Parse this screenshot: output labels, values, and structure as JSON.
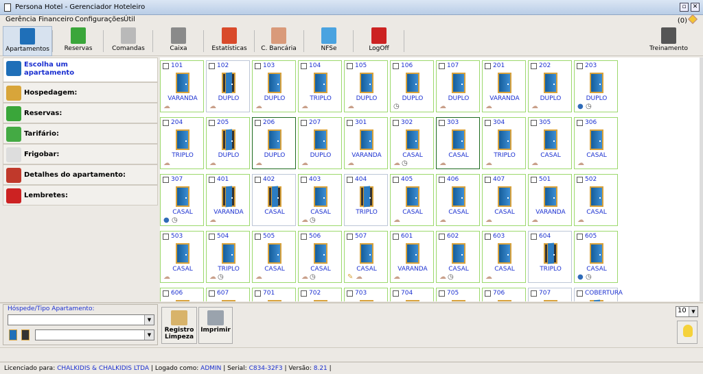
{
  "window": {
    "title": "Persona Hotel - Gerenciador Hoteleiro"
  },
  "menu": [
    "Gerência",
    "Financeiro",
    "Configurações",
    "Útil"
  ],
  "notification_count": "(0)",
  "toolbar": [
    {
      "label": "Apartamentos",
      "icon": "door-icon",
      "color": "#1f6fb8",
      "active": true
    },
    {
      "label": "Reservas",
      "icon": "calendar-icon",
      "color": "#3aa63a"
    },
    {
      "label": "Comandas",
      "icon": "cutlery-icon",
      "color": "#b9b9b9"
    },
    {
      "label": "Caixa",
      "icon": "cash-register-icon",
      "color": "#8a8a8a"
    },
    {
      "label": "Estatísticas",
      "icon": "chart-icon",
      "color": "#d94a2b"
    },
    {
      "label": "C. Bancária",
      "icon": "piggy-bank-icon",
      "color": "#d99a7a"
    },
    {
      "label": "NFSe",
      "icon": "nfse-icon",
      "color": "#4aa3e0"
    },
    {
      "label": "LogOff",
      "icon": "lock-icon",
      "color": "#cc2222"
    },
    {
      "label": "Treinamento",
      "icon": "film-icon",
      "color": "#555555"
    }
  ],
  "sidebar": [
    {
      "label": "Escolha um apartamento",
      "icon": "door-icon",
      "color": "#1f6fb8"
    },
    {
      "label": "Hospedagem:",
      "icon": "bell-icon",
      "color": "#d8a53a"
    },
    {
      "label": "Reservas:",
      "icon": "calendar-icon",
      "color": "#3aa63a"
    },
    {
      "label": "Tarifário:",
      "icon": "dollar-icon",
      "color": "#44aa44"
    },
    {
      "label": "Frigobar:",
      "icon": "fridge-icon",
      "color": "#dddddd"
    },
    {
      "label": "Detalhes do apartamento:",
      "icon": "sofa-icon",
      "color": "#c0392b"
    },
    {
      "label": "Lembretes:",
      "icon": "alarm-icon",
      "color": "#cc2222"
    }
  ],
  "rooms": [
    {
      "num": "101",
      "type": "VARANDA",
      "door": "closed",
      "border": "green",
      "status": [
        "clean"
      ]
    },
    {
      "num": "102",
      "type": "DUPLO",
      "door": "open",
      "border": "gray",
      "status": [
        "clean"
      ]
    },
    {
      "num": "103",
      "type": "DUPLO",
      "door": "closed",
      "border": "green",
      "status": [
        "clean"
      ]
    },
    {
      "num": "104",
      "type": "TRIPLO",
      "door": "closed",
      "border": "green",
      "status": [
        "clean"
      ]
    },
    {
      "num": "105",
      "type": "DUPLO",
      "door": "closed",
      "border": "green",
      "status": [
        "clean"
      ]
    },
    {
      "num": "106",
      "type": "DUPLO",
      "door": "closed",
      "border": "green",
      "status": [
        "clock"
      ]
    },
    {
      "num": "107",
      "type": "DUPLO",
      "door": "closed",
      "border": "green",
      "status": [
        "clean"
      ]
    },
    {
      "num": "201",
      "type": "VARANDA",
      "door": "closed",
      "border": "green",
      "status": [
        "clean"
      ]
    },
    {
      "num": "202",
      "type": "DUPLO",
      "door": "closed",
      "border": "green",
      "status": [
        "clean"
      ]
    },
    {
      "num": "203",
      "type": "DUPLO",
      "door": "closed",
      "border": "green",
      "status": [
        "guests",
        "clock"
      ]
    },
    {
      "num": "204",
      "type": "TRIPLO",
      "door": "closed",
      "border": "green",
      "status": [
        "clean"
      ]
    },
    {
      "num": "205",
      "type": "DUPLO",
      "door": "open",
      "border": "green",
      "status": [
        "clean"
      ]
    },
    {
      "num": "206",
      "type": "DUPLO",
      "door": "closed",
      "border": "dark",
      "status": [
        "clean"
      ]
    },
    {
      "num": "207",
      "type": "DUPLO",
      "door": "closed",
      "border": "green",
      "status": [
        "clean"
      ]
    },
    {
      "num": "301",
      "type": "VARANDA",
      "door": "closed",
      "border": "green",
      "status": [
        "clean"
      ]
    },
    {
      "num": "302",
      "type": "CASAL",
      "door": "closed",
      "border": "green",
      "status": [
        "clean",
        "clock"
      ]
    },
    {
      "num": "303",
      "type": "CASAL",
      "door": "closed",
      "border": "dark",
      "status": [
        "clean"
      ]
    },
    {
      "num": "304",
      "type": "TRIPLO",
      "door": "closed",
      "border": "green",
      "status": [
        "clean"
      ]
    },
    {
      "num": "305",
      "type": "CASAL",
      "door": "closed",
      "border": "green",
      "status": [
        "clean"
      ]
    },
    {
      "num": "306",
      "type": "CASAL",
      "door": "closed",
      "border": "green",
      "status": [
        "clean"
      ]
    },
    {
      "num": "307",
      "type": "CASAL",
      "door": "closed",
      "border": "green",
      "status": [
        "guests",
        "clock"
      ]
    },
    {
      "num": "401",
      "type": "VARANDA",
      "door": "open",
      "border": "green",
      "status": [
        "clean"
      ]
    },
    {
      "num": "402",
      "type": "CASAL",
      "door": "open",
      "border": "gray",
      "status": []
    },
    {
      "num": "403",
      "type": "CASAL",
      "door": "closed",
      "border": "green",
      "status": [
        "clean",
        "clock"
      ]
    },
    {
      "num": "404",
      "type": "TRIPLO",
      "door": "open",
      "border": "gray",
      "status": []
    },
    {
      "num": "405",
      "type": "CASAL",
      "door": "closed",
      "border": "green",
      "status": [
        "clean"
      ]
    },
    {
      "num": "406",
      "type": "CASAL",
      "door": "closed",
      "border": "green",
      "status": [
        "clean"
      ]
    },
    {
      "num": "407",
      "type": "CASAL",
      "door": "closed",
      "border": "green",
      "status": [
        "clean"
      ]
    },
    {
      "num": "501",
      "type": "VARANDA",
      "door": "closed",
      "border": "green",
      "status": [
        "clean"
      ]
    },
    {
      "num": "502",
      "type": "CASAL",
      "door": "closed",
      "border": "green",
      "status": [
        "clean"
      ]
    },
    {
      "num": "503",
      "type": "CASAL",
      "door": "closed",
      "border": "green",
      "status": [
        "clean"
      ]
    },
    {
      "num": "504",
      "type": "TRIPLO",
      "door": "closed",
      "border": "green",
      "status": [
        "clean",
        "clock"
      ]
    },
    {
      "num": "505",
      "type": "CASAL",
      "door": "closed",
      "border": "green",
      "status": [
        "clean"
      ]
    },
    {
      "num": "506",
      "type": "CASAL",
      "door": "closed",
      "border": "green",
      "status": [
        "clean",
        "clock"
      ]
    },
    {
      "num": "507",
      "type": "CASAL",
      "door": "closed",
      "border": "green",
      "status": [
        "broom",
        "clean"
      ]
    },
    {
      "num": "601",
      "type": "VARANDA",
      "door": "closed",
      "border": "green",
      "status": [
        "clean"
      ]
    },
    {
      "num": "602",
      "type": "CASAL",
      "door": "closed",
      "border": "green",
      "status": [
        "clean",
        "clock"
      ]
    },
    {
      "num": "603",
      "type": "CASAL",
      "door": "closed",
      "border": "green",
      "status": [
        "clean"
      ]
    },
    {
      "num": "604",
      "type": "TRIPLO",
      "door": "open",
      "border": "gray",
      "status": []
    },
    {
      "num": "605",
      "type": "CASAL",
      "door": "closed",
      "border": "green",
      "status": [
        "guests",
        "clock"
      ]
    },
    {
      "num": "606",
      "type": "",
      "door": "closed",
      "border": "green",
      "status": []
    },
    {
      "num": "607",
      "type": "",
      "door": "closed",
      "border": "green",
      "status": []
    },
    {
      "num": "701",
      "type": "",
      "door": "closed",
      "border": "green",
      "status": []
    },
    {
      "num": "702",
      "type": "",
      "door": "closed",
      "border": "green",
      "status": []
    },
    {
      "num": "703",
      "type": "",
      "door": "closed",
      "border": "green",
      "status": []
    },
    {
      "num": "704",
      "type": "",
      "door": "closed",
      "border": "green",
      "status": []
    },
    {
      "num": "705",
      "type": "",
      "door": "closed",
      "border": "green",
      "status": []
    },
    {
      "num": "706",
      "type": "",
      "door": "closed",
      "border": "green",
      "status": []
    },
    {
      "num": "707",
      "type": "",
      "door": "closed",
      "border": "gray",
      "status": []
    },
    {
      "num": "COBERTURA",
      "type": "",
      "door": "open",
      "border": "gray",
      "status": []
    }
  ],
  "search": {
    "legend": "Hóspede/Tipo Apartamento:"
  },
  "actions": {
    "cleaning_label_1": "Registro",
    "cleaning_label_2": "Limpeza",
    "print_label": "Imprimir"
  },
  "page_size": "10",
  "status": {
    "licensed_label": "Licenciado para:",
    "licensed_value": "CHALKIDIS & CHALKIDIS LTDA",
    "logged_label": "| Logado como:",
    "logged_value": "ADMIN",
    "serial_label": "| Serial:",
    "serial_value": "C834-32F3",
    "version_label": "| Versão:",
    "version_value": "8.21",
    "tail": "|"
  }
}
